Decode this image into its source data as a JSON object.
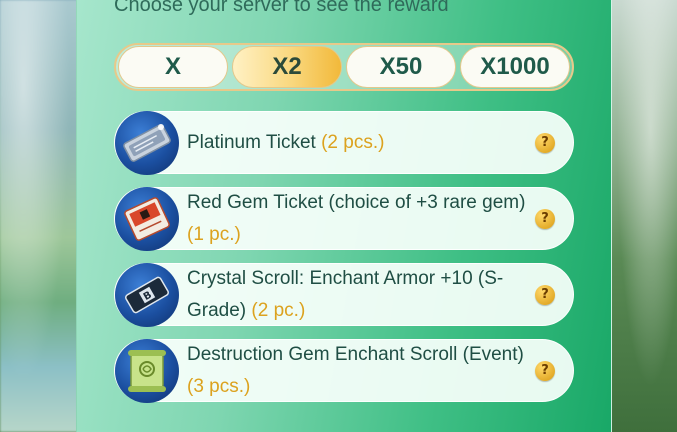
{
  "subtitle": "Choose your server to see the reward",
  "tabs": [
    {
      "label": "X",
      "active": false
    },
    {
      "label": "X2",
      "active": true
    },
    {
      "label": "X50",
      "active": false
    },
    {
      "label": "X1000",
      "active": false
    }
  ],
  "rewards": [
    {
      "name": "Platinum Ticket",
      "qty": "(2 pcs.)",
      "icon": "platinum-ticket-icon",
      "help": "?"
    },
    {
      "name": "Red Gem Ticket (choice of +3 rare gem)",
      "qty": "(1 pc.)",
      "icon": "red-gem-ticket-icon",
      "help": "?"
    },
    {
      "name": "Crystal Scroll: Enchant Armor +10 (S-Grade)",
      "qty": "(2 pc.)",
      "icon": "crystal-scroll-icon",
      "help": "?"
    },
    {
      "name": "Destruction Gem Enchant Scroll (Event)",
      "qty": "(3 pcs.)",
      "icon": "enchant-scroll-icon",
      "help": "?"
    }
  ],
  "colors": {
    "accent_gold": "#dca21e",
    "panel_green": "#19a867",
    "text_dark": "#1f4e44"
  }
}
